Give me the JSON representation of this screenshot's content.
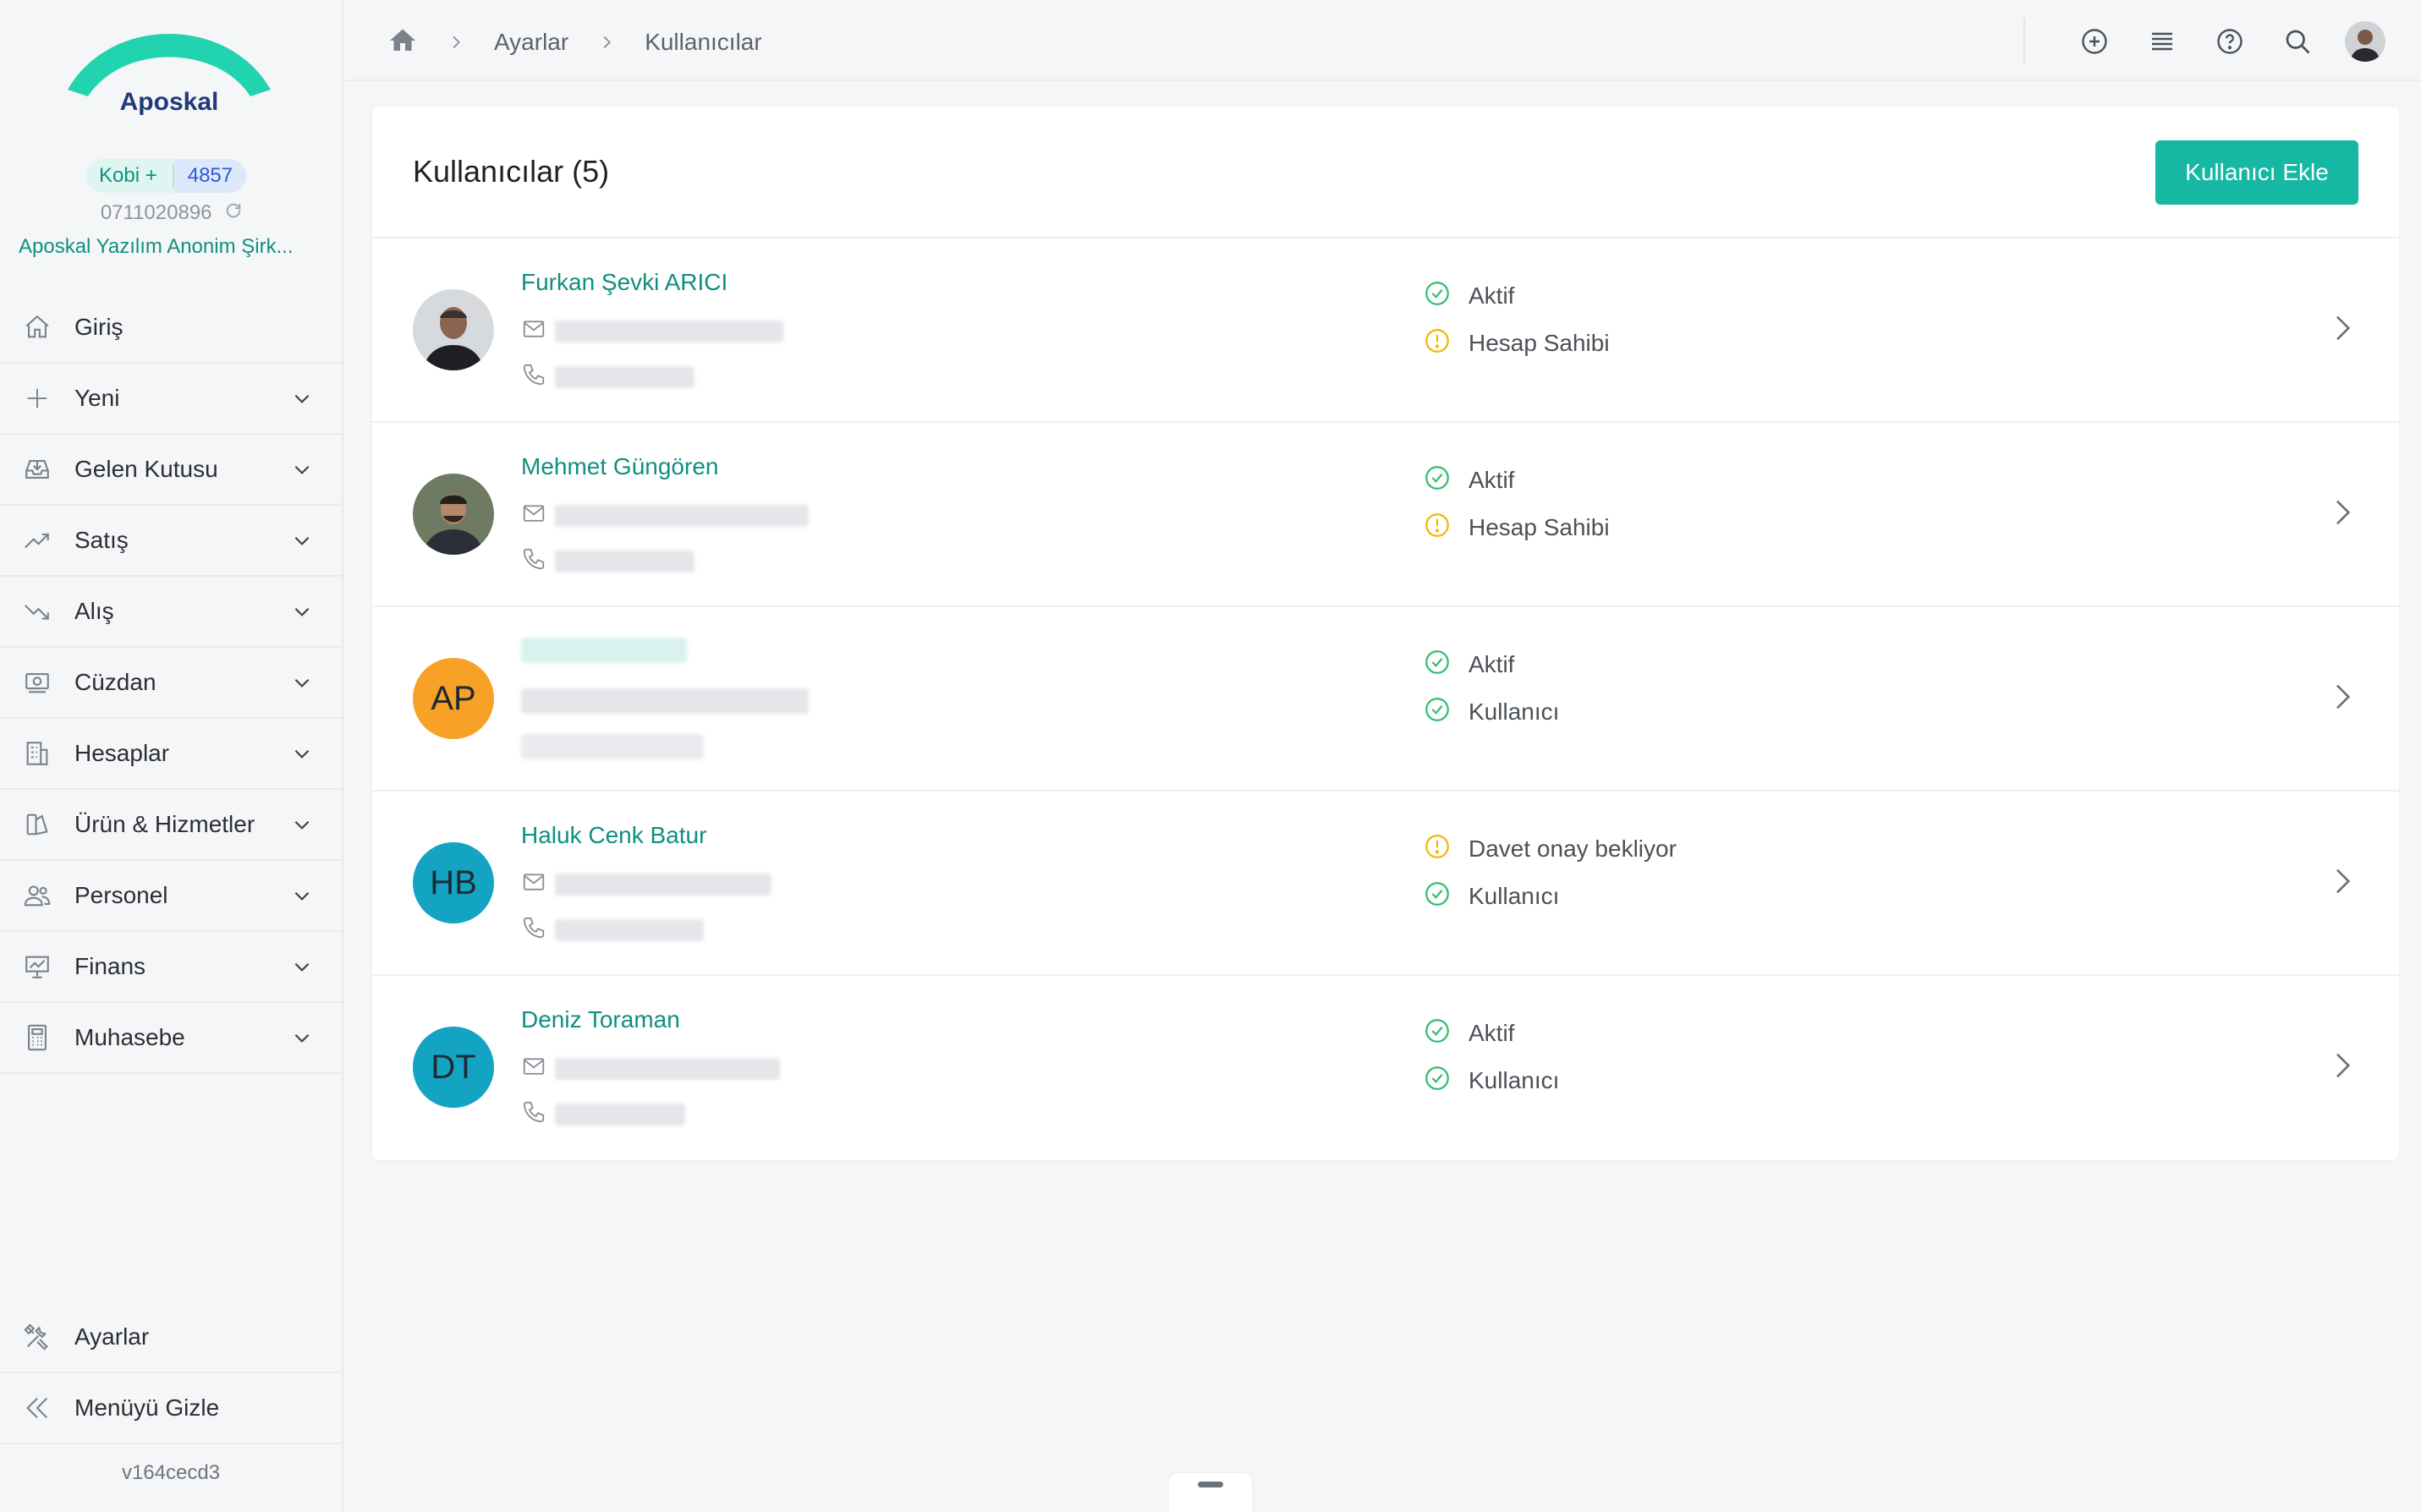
{
  "brand": {
    "name": "Aposkal",
    "accent": "#16b7a3",
    "link_color": "#0f8f80"
  },
  "account": {
    "plan": "Kobi +",
    "plan_number": "4857",
    "tax_no": "0711020896",
    "company": "Aposkal Yazılım Anonim Şirk..."
  },
  "sidebar": {
    "items": [
      {
        "label": "Giriş",
        "icon": "home-icon",
        "expandable": false
      },
      {
        "label": "Yeni",
        "icon": "plus-icon",
        "expandable": true
      },
      {
        "label": "Gelen Kutusu",
        "icon": "inbox-icon",
        "expandable": true
      },
      {
        "label": "Satış",
        "icon": "trend-up-icon",
        "expandable": true
      },
      {
        "label": "Alış",
        "icon": "trend-down-icon",
        "expandable": true
      },
      {
        "label": "Cüzdan",
        "icon": "wallet-icon",
        "expandable": true
      },
      {
        "label": "Hesaplar",
        "icon": "building-icon",
        "expandable": true
      },
      {
        "label": "Ürün & Hizmetler",
        "icon": "product-icon",
        "expandable": true
      },
      {
        "label": "Personel",
        "icon": "people-icon",
        "expandable": true
      },
      {
        "label": "Finans",
        "icon": "presentation-chart-icon",
        "expandable": true
      },
      {
        "label": "Muhasebe",
        "icon": "calculator-icon",
        "expandable": true
      }
    ],
    "bottom": [
      {
        "label": "Ayarlar",
        "icon": "tools-icon"
      },
      {
        "label": "Menüyü Gizle",
        "icon": "double-chevron-left-icon"
      }
    ],
    "version": "v164cecd3"
  },
  "breadcrumb": {
    "items": [
      "Ayarlar",
      "Kullanıcılar"
    ]
  },
  "page": {
    "title": "Kullanıcılar (5)",
    "add_button": "Kullanıcı Ekle"
  },
  "users": [
    {
      "name": "Furkan Şevki ARICI",
      "initials": "",
      "avatar_color": "",
      "status": "Aktif",
      "status_kind": "ok",
      "role": "Hesap Sahibi",
      "role_kind": "warn"
    },
    {
      "name": "Mehmet Güngören",
      "initials": "",
      "avatar_color": "",
      "status": "Aktif",
      "status_kind": "ok",
      "role": "Hesap Sahibi",
      "role_kind": "warn"
    },
    {
      "name": "",
      "initials": "AP",
      "avatar_color": "#f7a127",
      "status": "Aktif",
      "status_kind": "ok",
      "role": "Kullanıcı",
      "role_kind": "ok"
    },
    {
      "name": "Haluk Cenk Batur",
      "initials": "HB",
      "avatar_color": "#12a4c2",
      "status": "Davet onay bekliyor",
      "status_kind": "warn",
      "role": "Kullanıcı",
      "role_kind": "ok"
    },
    {
      "name": "Deniz Toraman",
      "initials": "DT",
      "avatar_color": "#12a4c2",
      "status": "Aktif",
      "status_kind": "ok",
      "role": "Kullanıcı",
      "role_kind": "ok"
    }
  ],
  "status_colors": {
    "ok": "#2fbf71",
    "warn": "#f2b705"
  }
}
